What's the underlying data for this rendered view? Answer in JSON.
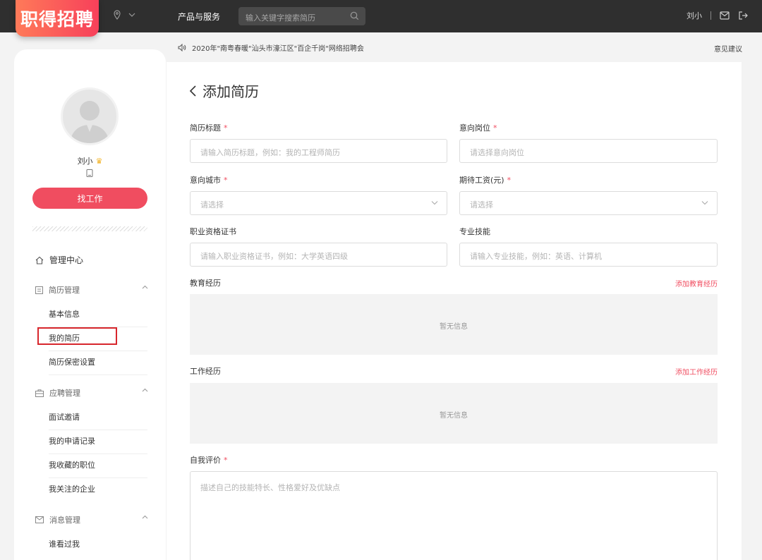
{
  "header": {
    "logo": "职得招聘",
    "nav_link": "产品与服务",
    "search_placeholder": "输入关键字搜索简历",
    "username": "刘小"
  },
  "notice": {
    "text": "2020年\"南粤春暖\"汕头市濠江区\"百企千岗\"网络招聘会",
    "feedback": "意见建议"
  },
  "sidebar": {
    "name": "刘小",
    "find_job": "找工作",
    "admin_center": "管理中心",
    "resume_group": "简历管理",
    "resume_items": [
      "基本信息",
      "我的简历",
      "简历保密设置"
    ],
    "apply_group": "应聘管理",
    "apply_items": [
      "面试邀请",
      "我的申请记录",
      "我收藏的职位",
      "我关注的企业"
    ],
    "msg_group": "消息管理",
    "msg_items": [
      "谁看过我"
    ]
  },
  "form": {
    "page_title": "添加简历",
    "title_label": "简历标题",
    "title_placeholder": "请输入简历标题，例如：我的工程师简历",
    "position_label": "意向岗位",
    "position_placeholder": "请选择意向岗位",
    "city_label": "意向城市",
    "city_placeholder": "请选择",
    "salary_label": "期待工资(元)",
    "salary_placeholder": "请选择",
    "cert_label": "职业资格证书",
    "cert_placeholder": "请输入职业资格证书，例如：大学英语四级",
    "skill_label": "专业技能",
    "skill_placeholder": "请输入专业技能，例如：英语、计算机",
    "edu_label": "教育经历",
    "edu_add": "添加教育经历",
    "edu_empty": "暂无信息",
    "work_label": "工作经历",
    "work_add": "添加工作经历",
    "work_empty": "暂无信息",
    "self_label": "自我评价",
    "self_placeholder": "描述自己的技能特长、性格爱好及优缺点",
    "required_mark": "*"
  }
}
